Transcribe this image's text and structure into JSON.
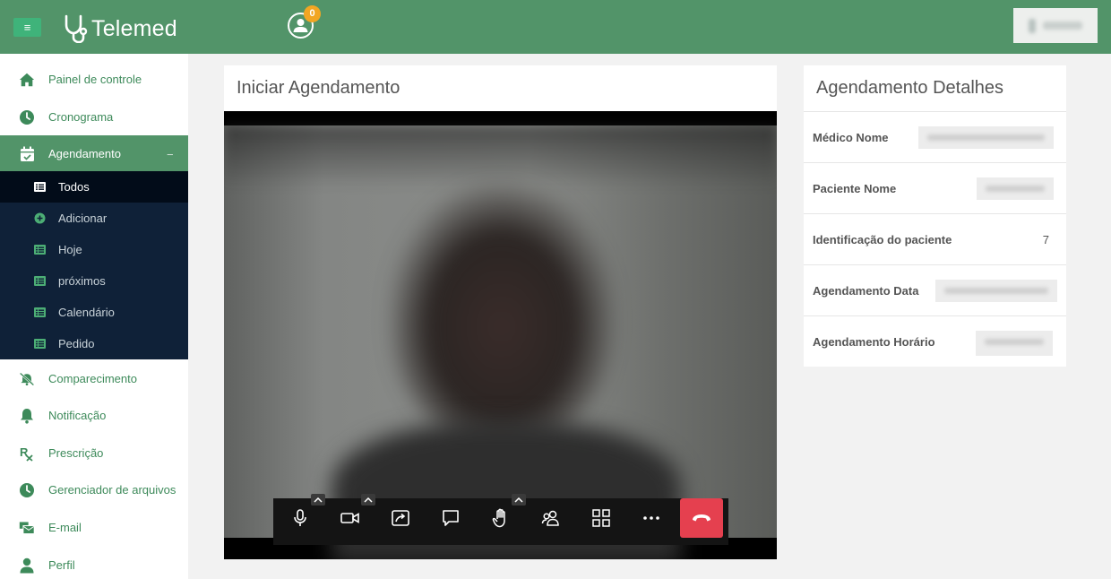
{
  "header": {
    "app_name": "Telemed",
    "notification_count": "0"
  },
  "sidebar": {
    "items": [
      {
        "label": "Painel de controle",
        "icon": "home-icon"
      },
      {
        "label": "Cronograma",
        "icon": "clock-icon"
      },
      {
        "label": "Agendamento",
        "icon": "calendar-check-icon",
        "expanded_indicator": "−"
      },
      {
        "label": "Comparecimento",
        "icon": "bell-slash-icon"
      },
      {
        "label": "Notificação",
        "icon": "bell-icon"
      },
      {
        "label": "Prescrição",
        "icon": "prescription-icon"
      },
      {
        "label": "Gerenciador de arquivos",
        "icon": "clock-icon"
      },
      {
        "label": "E-mail",
        "icon": "mail-bulk-icon"
      },
      {
        "label": "Perfil",
        "icon": "user-icon"
      }
    ],
    "submenu": [
      {
        "label": "Todos",
        "icon": "list-icon"
      },
      {
        "label": "Adicionar",
        "icon": "plus-circle-icon"
      },
      {
        "label": "Hoje",
        "icon": "list-icon"
      },
      {
        "label": "próximos",
        "icon": "list-icon"
      },
      {
        "label": "Calendário",
        "icon": "list-icon"
      },
      {
        "label": "Pedido",
        "icon": "list-icon"
      }
    ]
  },
  "main": {
    "title": "Iniciar Agendamento",
    "toolbar_icons": [
      "microphone-icon",
      "camera-icon",
      "screen-share-icon",
      "chat-icon",
      "raise-hand-icon",
      "participants-icon",
      "tile-view-icon",
      "more-icon",
      "hangup-icon"
    ]
  },
  "details": {
    "title": "Agendamento Detalhes",
    "rows": [
      {
        "label": "Médico Nome"
      },
      {
        "label": "Paciente Nome"
      },
      {
        "label": "Identificação do paciente",
        "value": "7"
      },
      {
        "label": "Agendamento Data"
      },
      {
        "label": "Agendamento Horário"
      }
    ]
  },
  "colors": {
    "brand_green": "#529469",
    "submenu_bg": "#0f2138",
    "hangup_red": "#e5404f",
    "badge_orange": "#f2a623"
  }
}
